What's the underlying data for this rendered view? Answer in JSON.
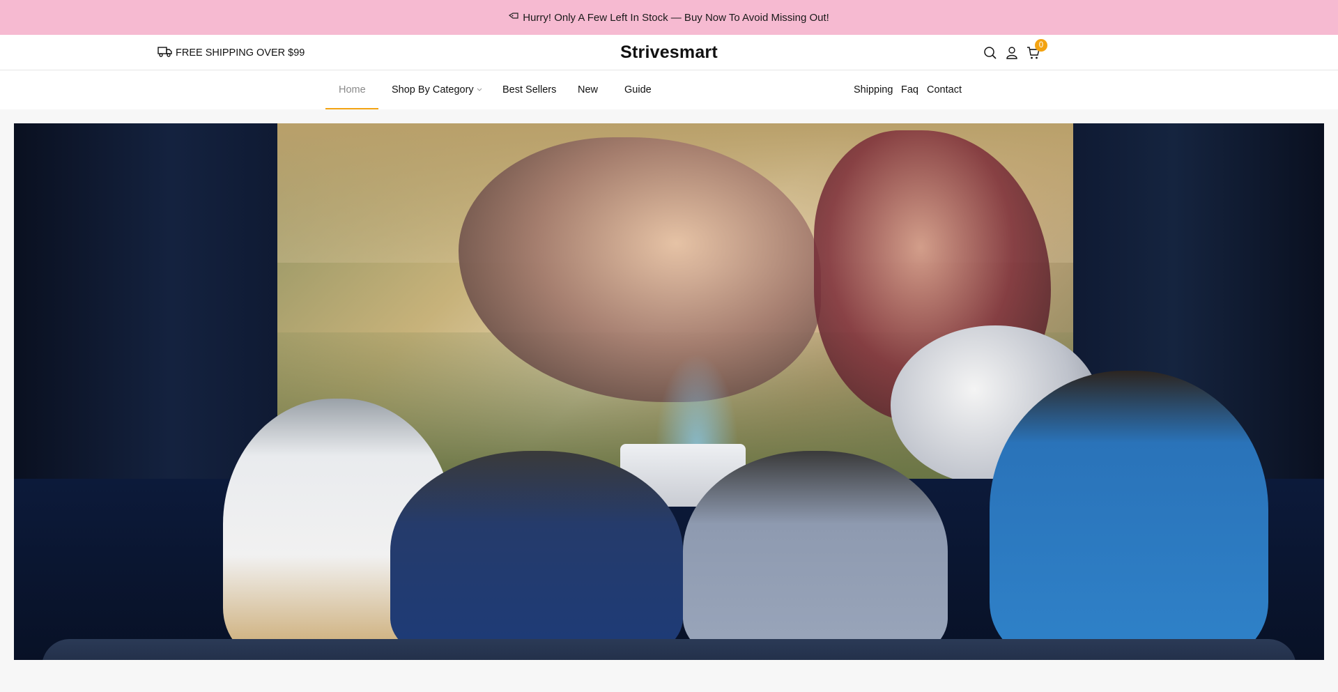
{
  "announcement": {
    "icon": "tag-icon",
    "text": "Hurry! Only A Few Left In Stock — Buy Now To Avoid Missing Out!"
  },
  "header": {
    "shipping_icon": "truck-icon",
    "shipping_text": "FREE SHIPPING OVER $99",
    "logo": "Strivesmart",
    "icons": [
      "search-icon",
      "user-icon",
      "cart-icon"
    ],
    "cart_count": "0"
  },
  "nav": {
    "left": [
      {
        "label": "Home",
        "active": true
      },
      {
        "label": "Shop By Category",
        "dropdown": true
      },
      {
        "label": "Best Sellers"
      },
      {
        "label": "New"
      },
      {
        "label": "Guide"
      }
    ],
    "right": [
      {
        "label": "Shipping"
      },
      {
        "label": "Faq"
      },
      {
        "label": "Contact"
      }
    ]
  },
  "hero": {
    "image": "friends-watching-soccer-projector-banner"
  },
  "colors": {
    "announcement_bg": "#f6bad1",
    "accent": "#f3a312"
  }
}
